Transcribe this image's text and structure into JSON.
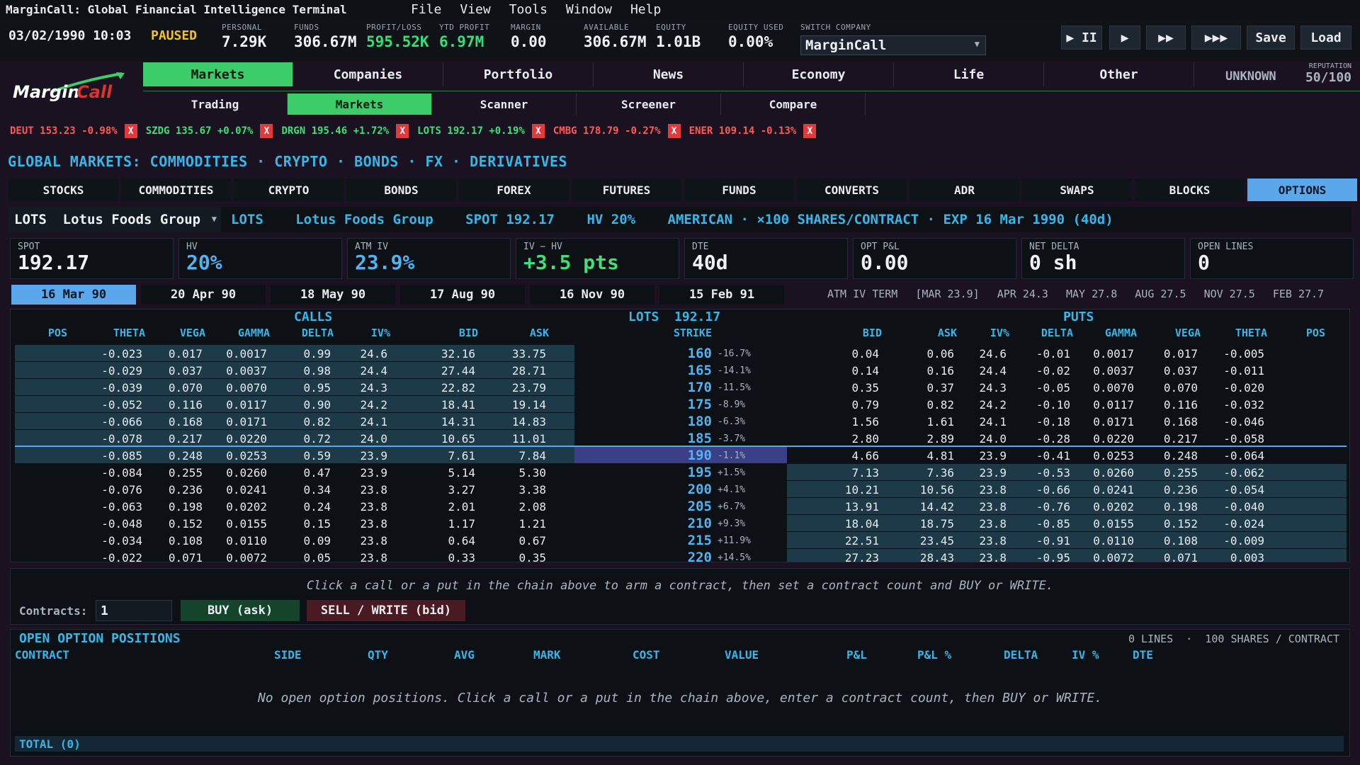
{
  "window": {
    "title": "MarginCall: Global Financial Intelligence Terminal",
    "menu": [
      "File",
      "View",
      "Tools",
      "Window",
      "Help"
    ]
  },
  "status": {
    "datetime": "03/02/1990 10:03",
    "state": "PAUSED",
    "stats": [
      {
        "label": "PERSONAL",
        "value": "7.29K"
      },
      {
        "label": "FUNDS",
        "value": "306.67M"
      },
      {
        "label": "PROFIT/LOSS",
        "value": "595.52K"
      },
      {
        "label": "YTD PROFIT",
        "value": "6.97M"
      },
      {
        "label": "MARGIN",
        "value": "0.00"
      },
      {
        "label": "AVAILABLE",
        "value": "306.67M"
      },
      {
        "label": "EQUITY",
        "value": "1.01B"
      },
      {
        "label": "EQUITY USED",
        "value": "0.00%"
      }
    ],
    "switch_company_label": "SWITCH COMPANY",
    "company": "MarginCall",
    "speed_buttons": [
      "▶ II",
      "▶",
      "▶▶",
      "▶▶▶"
    ],
    "save_label": "Save",
    "load_label": "Load"
  },
  "logo": {
    "part1": "Margin",
    "part2": "Call"
  },
  "mainnav": [
    "Markets",
    "Companies",
    "Portfolio",
    "News",
    "Economy",
    "Life",
    "Other"
  ],
  "mainnav_active": 0,
  "subnav": [
    "Trading",
    "Markets",
    "Scanner",
    "Screener",
    "Compare"
  ],
  "subnav_active": 1,
  "reputation": {
    "status": "UNKNOWN",
    "label": "REPUTATION",
    "value": "50/100"
  },
  "ticker": [
    {
      "text": "DEUT 153.23 -0.98%",
      "up": false
    },
    {
      "text": "SZDG 135.67 +0.07%",
      "up": true
    },
    {
      "text": "DRGN 195.46 +1.72%",
      "up": true
    },
    {
      "text": "LOTS 192.17 +0.19%",
      "up": true
    },
    {
      "text": "CMBG 178.79 -0.27%",
      "up": false
    },
    {
      "text": "ENER 109.14 -0.13%",
      "up": false
    }
  ],
  "section_title": "GLOBAL MARKETS: COMMODITIES · CRYPTO · BONDS · FX · DERIVATIVES",
  "asset_tabs": [
    "STOCKS",
    "COMMODITIES",
    "CRYPTO",
    "BONDS",
    "FOREX",
    "FUTURES",
    "FUNDS",
    "CONVERTS",
    "ADR",
    "SWAPS",
    "BLOCKS",
    "OPTIONS"
  ],
  "asset_tab_active": 11,
  "symbol": {
    "select_value": "LOTS  Lotus Foods Group",
    "info": [
      "LOTS",
      "Lotus Foods Group",
      "SPOT 192.17",
      "HV 20%",
      "AMERICAN · ×100 SHARES/CONTRACT · EXP 16 Mar 1990 (40d)"
    ]
  },
  "metrics": [
    {
      "label": "SPOT",
      "value": "192.17",
      "color": "white"
    },
    {
      "label": "HV",
      "value": "20%",
      "color": "blue"
    },
    {
      "label": "ATM IV",
      "value": "23.9%",
      "color": "blue"
    },
    {
      "label": "IV − HV",
      "value": "+3.5 pts",
      "color": "green"
    },
    {
      "label": "DTE",
      "value": "40d",
      "color": "white"
    },
    {
      "label": "OPT P&L",
      "value": "0.00",
      "color": "white"
    },
    {
      "label": "NET DELTA",
      "value": "0 sh",
      "color": "white"
    },
    {
      "label": "OPEN LINES",
      "value": "0",
      "color": "white"
    }
  ],
  "expiries": [
    "16 Mar 90",
    "20 Apr 90",
    "18 May 90",
    "17 Aug 90",
    "16 Nov 90",
    "15 Feb 91"
  ],
  "expiry_active": 0,
  "atm_term": [
    "ATM IV TERM",
    "[MAR 23.9]",
    "APR 24.3",
    "MAY 27.8",
    "AUG 27.5",
    "NOV 27.5",
    "FEB 27.7"
  ],
  "chain": {
    "calls_label": "CALLS",
    "center_label": "LOTS  192.17",
    "puts_label": "PUTS",
    "headers": {
      "calls": [
        "POS",
        "THETA",
        "VEGA",
        "GAMMA",
        "DELTA",
        "IV%",
        "BID",
        "ASK"
      ],
      "strike": "STRIKE",
      "puts": [
        "BID",
        "ASK",
        "IV%",
        "DELTA",
        "GAMMA",
        "VEGA",
        "THETA",
        "POS"
      ]
    },
    "rows": [
      {
        "strike": "160",
        "pct": "-16.7%",
        "c_theta": "-0.023",
        "c_vega": "0.017",
        "c_gamma": "0.0017",
        "c_delta": "0.99",
        "c_iv": "24.6",
        "c_bid": "32.16",
        "c_ask": "33.75",
        "p_bid": "0.04",
        "p_ask": "0.06",
        "p_iv": "24.6",
        "p_delta": "-0.01",
        "p_gamma": "0.0017",
        "p_vega": "0.017",
        "p_theta": "-0.005",
        "call_itm": true,
        "put_itm": false
      },
      {
        "strike": "165",
        "pct": "-14.1%",
        "c_theta": "-0.029",
        "c_vega": "0.037",
        "c_gamma": "0.0037",
        "c_delta": "0.98",
        "c_iv": "24.4",
        "c_bid": "27.44",
        "c_ask": "28.71",
        "p_bid": "0.14",
        "p_ask": "0.16",
        "p_iv": "24.4",
        "p_delta": "-0.02",
        "p_gamma": "0.0037",
        "p_vega": "0.037",
        "p_theta": "-0.011",
        "call_itm": true,
        "put_itm": false
      },
      {
        "strike": "170",
        "pct": "-11.5%",
        "c_theta": "-0.039",
        "c_vega": "0.070",
        "c_gamma": "0.0070",
        "c_delta": "0.95",
        "c_iv": "24.3",
        "c_bid": "22.82",
        "c_ask": "23.79",
        "p_bid": "0.35",
        "p_ask": "0.37",
        "p_iv": "24.3",
        "p_delta": "-0.05",
        "p_gamma": "0.0070",
        "p_vega": "0.070",
        "p_theta": "-0.020",
        "call_itm": true,
        "put_itm": false
      },
      {
        "strike": "175",
        "pct": "-8.9%",
        "c_theta": "-0.052",
        "c_vega": "0.116",
        "c_gamma": "0.0117",
        "c_delta": "0.90",
        "c_iv": "24.2",
        "c_bid": "18.41",
        "c_ask": "19.14",
        "p_bid": "0.79",
        "p_ask": "0.82",
        "p_iv": "24.2",
        "p_delta": "-0.10",
        "p_gamma": "0.0117",
        "p_vega": "0.116",
        "p_theta": "-0.032",
        "call_itm": true,
        "put_itm": false
      },
      {
        "strike": "180",
        "pct": "-6.3%",
        "c_theta": "-0.066",
        "c_vega": "0.168",
        "c_gamma": "0.0171",
        "c_delta": "0.82",
        "c_iv": "24.1",
        "c_bid": "14.31",
        "c_ask": "14.83",
        "p_bid": "1.56",
        "p_ask": "1.61",
        "p_iv": "24.1",
        "p_delta": "-0.18",
        "p_gamma": "0.0171",
        "p_vega": "0.168",
        "p_theta": "-0.046",
        "call_itm": true,
        "put_itm": false
      },
      {
        "strike": "185",
        "pct": "-3.7%",
        "c_theta": "-0.078",
        "c_vega": "0.217",
        "c_gamma": "0.0220",
        "c_delta": "0.72",
        "c_iv": "24.0",
        "c_bid": "10.65",
        "c_ask": "11.01",
        "p_bid": "2.80",
        "p_ask": "2.89",
        "p_iv": "24.0",
        "p_delta": "-0.28",
        "p_gamma": "0.0220",
        "p_vega": "0.217",
        "p_theta": "-0.058",
        "call_itm": true,
        "put_itm": false
      },
      {
        "strike": "190",
        "pct": "-1.1%",
        "c_theta": "-0.085",
        "c_vega": "0.248",
        "c_gamma": "0.0253",
        "c_delta": "0.59",
        "c_iv": "23.9",
        "c_bid": "7.61",
        "c_ask": "7.84",
        "p_bid": "4.66",
        "p_ask": "4.81",
        "p_iv": "23.9",
        "p_delta": "-0.41",
        "p_gamma": "0.0253",
        "p_vega": "0.248",
        "p_theta": "-0.064",
        "call_itm": true,
        "put_itm": false,
        "atm": true
      },
      {
        "strike": "195",
        "pct": "+1.5%",
        "c_theta": "-0.084",
        "c_vega": "0.255",
        "c_gamma": "0.0260",
        "c_delta": "0.47",
        "c_iv": "23.9",
        "c_bid": "5.14",
        "c_ask": "5.30",
        "p_bid": "7.13",
        "p_ask": "7.36",
        "p_iv": "23.9",
        "p_delta": "-0.53",
        "p_gamma": "0.0260",
        "p_vega": "0.255",
        "p_theta": "-0.062",
        "call_itm": false,
        "put_itm": true
      },
      {
        "strike": "200",
        "pct": "+4.1%",
        "c_theta": "-0.076",
        "c_vega": "0.236",
        "c_gamma": "0.0241",
        "c_delta": "0.34",
        "c_iv": "23.8",
        "c_bid": "3.27",
        "c_ask": "3.38",
        "p_bid": "10.21",
        "p_ask": "10.56",
        "p_iv": "23.8",
        "p_delta": "-0.66",
        "p_gamma": "0.0241",
        "p_vega": "0.236",
        "p_theta": "-0.054",
        "call_itm": false,
        "put_itm": true
      },
      {
        "strike": "205",
        "pct": "+6.7%",
        "c_theta": "-0.063",
        "c_vega": "0.198",
        "c_gamma": "0.0202",
        "c_delta": "0.24",
        "c_iv": "23.8",
        "c_bid": "2.01",
        "c_ask": "2.08",
        "p_bid": "13.91",
        "p_ask": "14.42",
        "p_iv": "23.8",
        "p_delta": "-0.76",
        "p_gamma": "0.0202",
        "p_vega": "0.198",
        "p_theta": "-0.040",
        "call_itm": false,
        "put_itm": true
      },
      {
        "strike": "210",
        "pct": "+9.3%",
        "c_theta": "-0.048",
        "c_vega": "0.152",
        "c_gamma": "0.0155",
        "c_delta": "0.15",
        "c_iv": "23.8",
        "c_bid": "1.17",
        "c_ask": "1.21",
        "p_bid": "18.04",
        "p_ask": "18.75",
        "p_iv": "23.8",
        "p_delta": "-0.85",
        "p_gamma": "0.0155",
        "p_vega": "0.152",
        "p_theta": "-0.024",
        "call_itm": false,
        "put_itm": true
      },
      {
        "strike": "215",
        "pct": "+11.9%",
        "c_theta": "-0.034",
        "c_vega": "0.108",
        "c_gamma": "0.0110",
        "c_delta": "0.09",
        "c_iv": "23.8",
        "c_bid": "0.64",
        "c_ask": "0.67",
        "p_bid": "22.51",
        "p_ask": "23.45",
        "p_iv": "23.8",
        "p_delta": "-0.91",
        "p_gamma": "0.0110",
        "p_vega": "0.108",
        "p_theta": "-0.009",
        "call_itm": false,
        "put_itm": true
      },
      {
        "strike": "220",
        "pct": "+14.5%",
        "c_theta": "-0.022",
        "c_vega": "0.071",
        "c_gamma": "0.0072",
        "c_delta": "0.05",
        "c_iv": "23.8",
        "c_bid": "0.33",
        "c_ask": "0.35",
        "p_bid": "27.23",
        "p_ask": "28.43",
        "p_iv": "23.8",
        "p_delta": "-0.95",
        "p_gamma": "0.0072",
        "p_vega": "0.071",
        "p_theta": "0.003",
        "call_itm": false,
        "put_itm": true
      }
    ]
  },
  "order": {
    "hint": "Click a call or a put in the chain above to arm a contract, then set a contract count and BUY or WRITE.",
    "contracts_label": "Contracts:",
    "contracts_value": "1",
    "buy_label": "BUY (ask)",
    "sell_label": "SELL / WRITE (bid)"
  },
  "positions": {
    "title": "OPEN OPTION POSITIONS",
    "meta": "0 LINES  ·  100 SHARES / CONTRACT",
    "headers": [
      "CONTRACT",
      "SIDE",
      "QTY",
      "AVG",
      "MARK",
      "COST",
      "VALUE",
      "P&L",
      "P&L %",
      "DELTA",
      "IV %",
      "DTE"
    ],
    "empty": "No open option positions. Click a call or a put in the chain above, enter a contract count, then BUY or WRITE.",
    "total": "TOTAL (0)"
  }
}
